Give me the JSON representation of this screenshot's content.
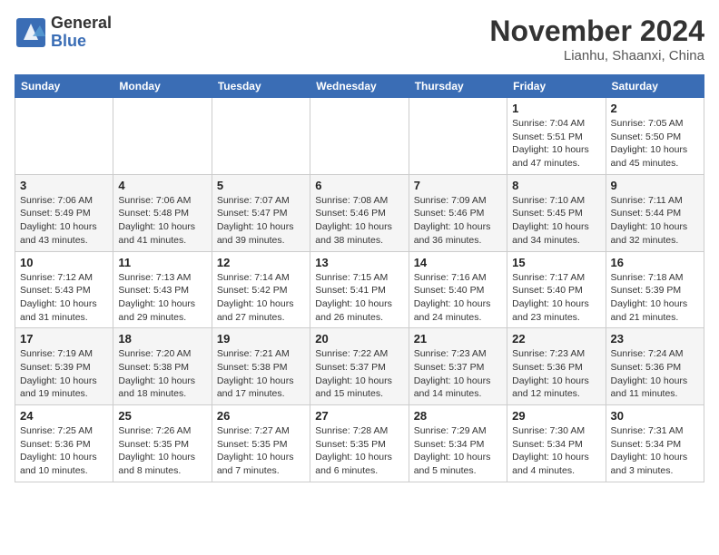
{
  "logo": {
    "general": "General",
    "blue": "Blue"
  },
  "header": {
    "month": "November 2024",
    "location": "Lianhu, Shaanxi, China"
  },
  "weekdays": [
    "Sunday",
    "Monday",
    "Tuesday",
    "Wednesday",
    "Thursday",
    "Friday",
    "Saturday"
  ],
  "weeks": [
    [
      {
        "day": "",
        "info": ""
      },
      {
        "day": "",
        "info": ""
      },
      {
        "day": "",
        "info": ""
      },
      {
        "day": "",
        "info": ""
      },
      {
        "day": "",
        "info": ""
      },
      {
        "day": "1",
        "info": "Sunrise: 7:04 AM\nSunset: 5:51 PM\nDaylight: 10 hours\nand 47 minutes."
      },
      {
        "day": "2",
        "info": "Sunrise: 7:05 AM\nSunset: 5:50 PM\nDaylight: 10 hours\nand 45 minutes."
      }
    ],
    [
      {
        "day": "3",
        "info": "Sunrise: 7:06 AM\nSunset: 5:49 PM\nDaylight: 10 hours\nand 43 minutes."
      },
      {
        "day": "4",
        "info": "Sunrise: 7:06 AM\nSunset: 5:48 PM\nDaylight: 10 hours\nand 41 minutes."
      },
      {
        "day": "5",
        "info": "Sunrise: 7:07 AM\nSunset: 5:47 PM\nDaylight: 10 hours\nand 39 minutes."
      },
      {
        "day": "6",
        "info": "Sunrise: 7:08 AM\nSunset: 5:46 PM\nDaylight: 10 hours\nand 38 minutes."
      },
      {
        "day": "7",
        "info": "Sunrise: 7:09 AM\nSunset: 5:46 PM\nDaylight: 10 hours\nand 36 minutes."
      },
      {
        "day": "8",
        "info": "Sunrise: 7:10 AM\nSunset: 5:45 PM\nDaylight: 10 hours\nand 34 minutes."
      },
      {
        "day": "9",
        "info": "Sunrise: 7:11 AM\nSunset: 5:44 PM\nDaylight: 10 hours\nand 32 minutes."
      }
    ],
    [
      {
        "day": "10",
        "info": "Sunrise: 7:12 AM\nSunset: 5:43 PM\nDaylight: 10 hours\nand 31 minutes."
      },
      {
        "day": "11",
        "info": "Sunrise: 7:13 AM\nSunset: 5:43 PM\nDaylight: 10 hours\nand 29 minutes."
      },
      {
        "day": "12",
        "info": "Sunrise: 7:14 AM\nSunset: 5:42 PM\nDaylight: 10 hours\nand 27 minutes."
      },
      {
        "day": "13",
        "info": "Sunrise: 7:15 AM\nSunset: 5:41 PM\nDaylight: 10 hours\nand 26 minutes."
      },
      {
        "day": "14",
        "info": "Sunrise: 7:16 AM\nSunset: 5:40 PM\nDaylight: 10 hours\nand 24 minutes."
      },
      {
        "day": "15",
        "info": "Sunrise: 7:17 AM\nSunset: 5:40 PM\nDaylight: 10 hours\nand 23 minutes."
      },
      {
        "day": "16",
        "info": "Sunrise: 7:18 AM\nSunset: 5:39 PM\nDaylight: 10 hours\nand 21 minutes."
      }
    ],
    [
      {
        "day": "17",
        "info": "Sunrise: 7:19 AM\nSunset: 5:39 PM\nDaylight: 10 hours\nand 19 minutes."
      },
      {
        "day": "18",
        "info": "Sunrise: 7:20 AM\nSunset: 5:38 PM\nDaylight: 10 hours\nand 18 minutes."
      },
      {
        "day": "19",
        "info": "Sunrise: 7:21 AM\nSunset: 5:38 PM\nDaylight: 10 hours\nand 17 minutes."
      },
      {
        "day": "20",
        "info": "Sunrise: 7:22 AM\nSunset: 5:37 PM\nDaylight: 10 hours\nand 15 minutes."
      },
      {
        "day": "21",
        "info": "Sunrise: 7:23 AM\nSunset: 5:37 PM\nDaylight: 10 hours\nand 14 minutes."
      },
      {
        "day": "22",
        "info": "Sunrise: 7:23 AM\nSunset: 5:36 PM\nDaylight: 10 hours\nand 12 minutes."
      },
      {
        "day": "23",
        "info": "Sunrise: 7:24 AM\nSunset: 5:36 PM\nDaylight: 10 hours\nand 11 minutes."
      }
    ],
    [
      {
        "day": "24",
        "info": "Sunrise: 7:25 AM\nSunset: 5:36 PM\nDaylight: 10 hours\nand 10 minutes."
      },
      {
        "day": "25",
        "info": "Sunrise: 7:26 AM\nSunset: 5:35 PM\nDaylight: 10 hours\nand 8 minutes."
      },
      {
        "day": "26",
        "info": "Sunrise: 7:27 AM\nSunset: 5:35 PM\nDaylight: 10 hours\nand 7 minutes."
      },
      {
        "day": "27",
        "info": "Sunrise: 7:28 AM\nSunset: 5:35 PM\nDaylight: 10 hours\nand 6 minutes."
      },
      {
        "day": "28",
        "info": "Sunrise: 7:29 AM\nSunset: 5:34 PM\nDaylight: 10 hours\nand 5 minutes."
      },
      {
        "day": "29",
        "info": "Sunrise: 7:30 AM\nSunset: 5:34 PM\nDaylight: 10 hours\nand 4 minutes."
      },
      {
        "day": "30",
        "info": "Sunrise: 7:31 AM\nSunset: 5:34 PM\nDaylight: 10 hours\nand 3 minutes."
      }
    ]
  ]
}
